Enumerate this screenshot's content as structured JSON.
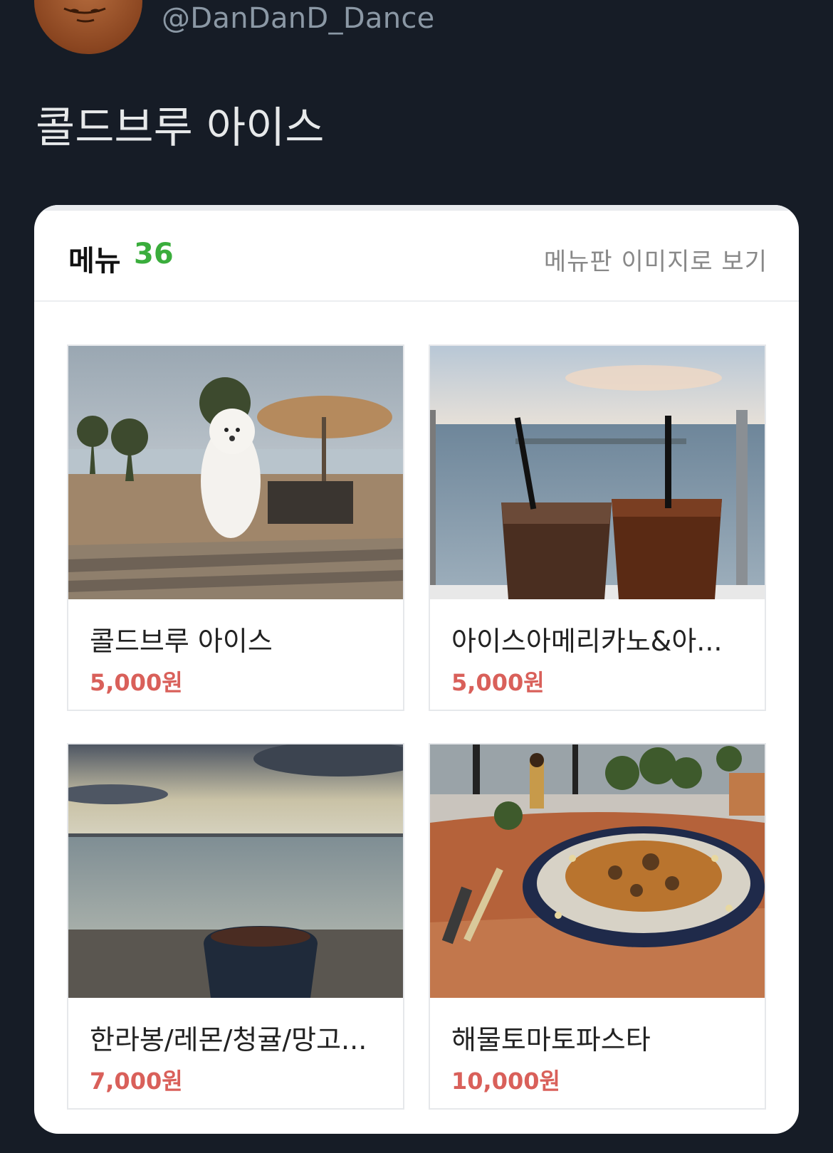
{
  "tweet": {
    "handle": "@DanDanD_Dance",
    "text": "콜드브루 아이스"
  },
  "card": {
    "menu_label": "메뉴",
    "menu_count": "36",
    "view_link": "메뉴판 이미지로 보기",
    "items": [
      {
        "name": "콜드브루 아이스",
        "price": "5,000원",
        "image": "dog-on-beach-table-photo"
      },
      {
        "name": "아이스아메리카노&아...",
        "price": "5,000원",
        "image": "iced-coffee-ocean-photo"
      },
      {
        "name": "한라봉/레몬/청귤/망고...",
        "price": "7,000원",
        "image": "cup-ocean-sunset-photo"
      },
      {
        "name": "해물토마토파스타",
        "price": "10,000원",
        "image": "seafood-pasta-plate-photo"
      }
    ]
  },
  "colors": {
    "background": "#161c26",
    "accent_green": "#3aad3c",
    "price_red": "#d9605a"
  }
}
